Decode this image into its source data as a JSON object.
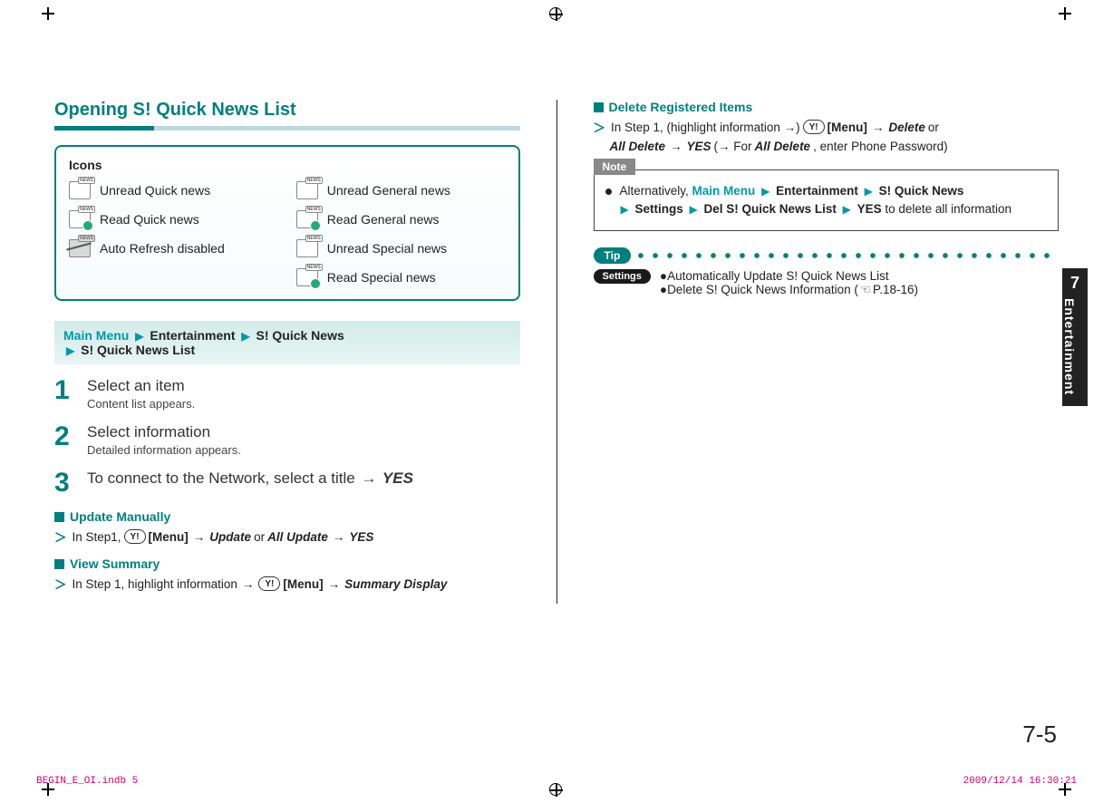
{
  "section_title": "Opening S! Quick News List",
  "icons_box": {
    "title": "Icons",
    "items": [
      {
        "label": "Unread Quick news"
      },
      {
        "label": "Unread General news"
      },
      {
        "label": "Read Quick news"
      },
      {
        "label": "Read General news"
      },
      {
        "label": "Auto Refresh disabled"
      },
      {
        "label": "Unread Special news"
      },
      {
        "label": ""
      },
      {
        "label": "Read Special news"
      }
    ]
  },
  "nav": {
    "p1": "Main Menu",
    "p2": "Entertainment",
    "p3": "S! Quick News",
    "p4": "S! Quick News List"
  },
  "steps": [
    {
      "main": "Select an item",
      "sub": "Content list appears."
    },
    {
      "main": "Select information",
      "sub": "Detailed information appears."
    },
    {
      "main_prefix": "To connect to the Network, select a title ",
      "arrow": "→",
      "main_bold": " YES",
      "sub": ""
    }
  ],
  "update_manually": {
    "title": "Update Manually",
    "pre": "In Step1, ",
    "key": "Y!",
    "menu": "[Menu]",
    "opt1": "Update",
    "or": " or ",
    "opt2": "All Update",
    "yes": "YES"
  },
  "view_summary": {
    "title": "View Summary",
    "pre": "In Step 1, highlight information ",
    "key": "Y!",
    "menu": "[Menu]",
    "opt": "Summary Display"
  },
  "delete_registered": {
    "title": "Delete Registered Items",
    "pre": "In Step 1, (highlight information →) ",
    "key": "Y!",
    "menu": "[Menu]",
    "opt1": "Delete",
    "or": " or ",
    "line2_a": "All Delete",
    "line2_yes": "YES",
    "line2_paren_pre": " (→ For ",
    "line2_paren_bold": "All Delete",
    "line2_paren_post": ", enter Phone Password)"
  },
  "note": {
    "tab": "Note",
    "lead": "Alternatively, ",
    "p1": "Main Menu",
    "p2": "Entertainment",
    "p3": "S! Quick News",
    "p4": "Settings",
    "p5": "Del S! Quick News List",
    "p6": "YES",
    "tail": " to delete all information"
  },
  "tip": {
    "label": "Tip",
    "settings_label": "Settings",
    "item1": "Automatically Update S! Quick News List",
    "item2_pre": "Delete S! Quick News Information (",
    "item2_ref": "P.18-16",
    "item2_post": ")"
  },
  "side_tab": {
    "num": "7",
    "text": "Entertainment"
  },
  "page_number": "7-5",
  "footer": {
    "left": "BEGIN_E_OI.indb   5",
    "right": "2009/12/14   16:30:21"
  }
}
